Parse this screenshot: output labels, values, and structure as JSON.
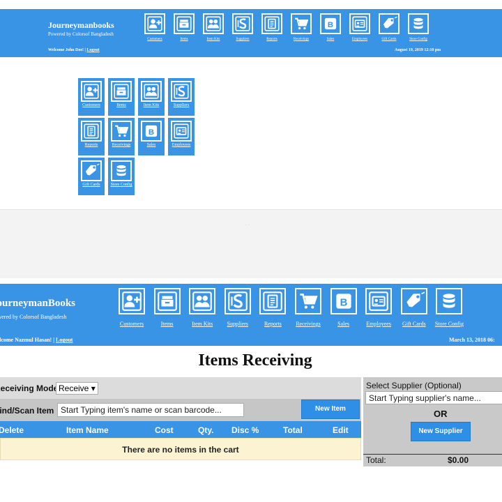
{
  "top_header": {
    "brand": "Journeymanbooks",
    "powered_by": "Powered by Colorsof Bangladesh",
    "welcome": "Welcome John Doe! |",
    "logout": "Logout",
    "datetime": "August 19, 2019 12:10 pm",
    "nav": [
      "Customers",
      "Items",
      "Item Kits",
      "Suppliers",
      "Reports",
      "Receivings",
      "Sales",
      "Employees",
      "Gift Cards",
      "Store Config"
    ]
  },
  "module_grid": {
    "items": [
      "Customers",
      "Items",
      "Item Kits",
      "Suppliers",
      "Reports",
      "Receivings",
      "Sales",
      "Employees",
      "Gift Cards",
      "Store Config"
    ]
  },
  "bottom_header": {
    "brand": "JourneymanBooks",
    "powered_by": "Powered by Colorsof Bangladesh",
    "welcome": "Welcome Nazmul Hasan! |",
    "logout": "Logout",
    "datetime": "March 13, 2018 06:",
    "nav": [
      "Customers",
      "Items",
      "Item Kits",
      "Suppliers",
      "Reports",
      "Receivings",
      "Sales",
      "Employees",
      "Gift Cards",
      "Store Config"
    ]
  },
  "receiving": {
    "title": "Items Receiving",
    "mode_label": "Receiving Mode",
    "mode_value": "Receive ▾",
    "find_label": "Find/Scan Item",
    "find_placeholder": "Start Typing item's name or scan barcode...",
    "new_item": "New Item",
    "columns": [
      "Delete",
      "Item Name",
      "Cost",
      "Qty.",
      "Disc %",
      "Total",
      "Edit"
    ],
    "empty_message": "There are no items in the cart"
  },
  "supplier_panel": {
    "label": "Select Supplier (Optional)",
    "placeholder": "Start Typing supplier's name...",
    "or": "OR",
    "new_supplier": "New Supplier",
    "total_label": "Total:",
    "total_value": "$0.00"
  },
  "colors": {
    "header_blue": "#3a94e6",
    "cart_empty_bg": "#fbf3d2",
    "panel_gray": "#c9c9c9"
  },
  "icons": [
    "customers-icon",
    "items-icon",
    "item-kits-icon",
    "suppliers-icon",
    "reports-icon",
    "receivings-icon",
    "sales-icon",
    "employees-icon",
    "gift-cards-icon",
    "store-config-icon"
  ]
}
